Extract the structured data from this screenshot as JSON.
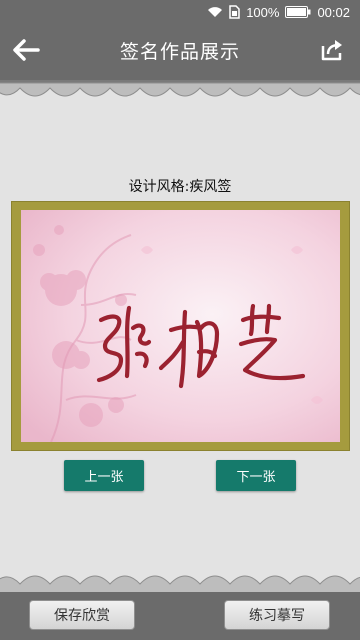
{
  "status_bar": {
    "battery_percent": "100%",
    "time": "00:02",
    "icons": [
      "wifi-icon",
      "sim-icon",
      "battery-icon"
    ]
  },
  "header": {
    "title": "签名作品展示",
    "back_icon": "back-arrow-icon",
    "share_icon": "share-icon"
  },
  "content": {
    "style_caption": "设计风格:疾风签",
    "artwork_signature": "张柏芝",
    "prev_button": "上一张",
    "next_button": "下一张"
  },
  "bottom_bar": {
    "save_button": "保存欣赏",
    "practice_button": "练习摹写"
  },
  "colors": {
    "bar_gray": "#6b6b6b",
    "background": "#e3e3e3",
    "frame_gold": "#a59b3e",
    "nav_button_green": "#157a6b",
    "ink_red": "#9b2230"
  }
}
